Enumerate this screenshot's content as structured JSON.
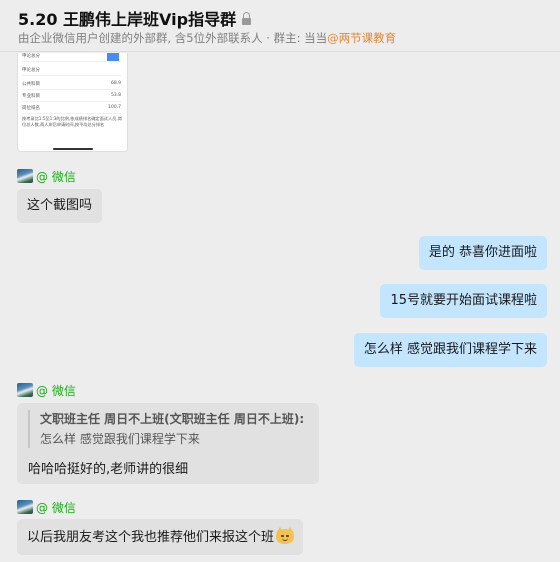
{
  "header": {
    "title": "5.20  王鹏伟上岸班Vip指导群",
    "subtitle_prefix": "由企业微信用户创建的外部群, 含5位外部联系人 · 群主: 当当",
    "owner": "@两节课教育"
  },
  "thumbnail": {
    "button_label": "",
    "rows": [
      {
        "label": "申论总分",
        "value": ""
      },
      {
        "label": "公共科目",
        "value": "68.9"
      },
      {
        "label": "专业科目",
        "value": "53.8"
      },
      {
        "label": "岗位排名",
        "value": "100.7"
      }
    ],
    "note": "按考录比1:5至1:3的比例,依成绩排名确定面试人员,岗位总人数,两人岸后申请时间,按平均总分排名"
  },
  "messages": [
    {
      "sender": "@ 微信",
      "text": "这个截图吗"
    },
    {
      "text": "是的  恭喜你进面啦"
    },
    {
      "text": "15号就要开始面试课程啦"
    },
    {
      "text": "怎么样 感觉跟我们课程学下来"
    },
    {
      "sender": "@ 微信",
      "quote_name": "文职班主任 周日不上班(文职班主任 周日不上班):",
      "quote_text": "怎么样 感觉跟我们课程学下来",
      "text": "哈哈哈挺好的,老师讲的很细"
    },
    {
      "sender": "@ 微信",
      "text": "以后我朋友考这个我也推荐他们来报这个班"
    }
  ],
  "colors": {
    "background": "#ededed",
    "incoming_bubble": "#e1e1e1",
    "outgoing_bubble": "#c4e5fe",
    "sender_label": "#1aad19",
    "owner_link": "#e0883a"
  },
  "icons": [
    "lock-icon",
    "avatar-image",
    "cat-grin-emoji"
  ]
}
